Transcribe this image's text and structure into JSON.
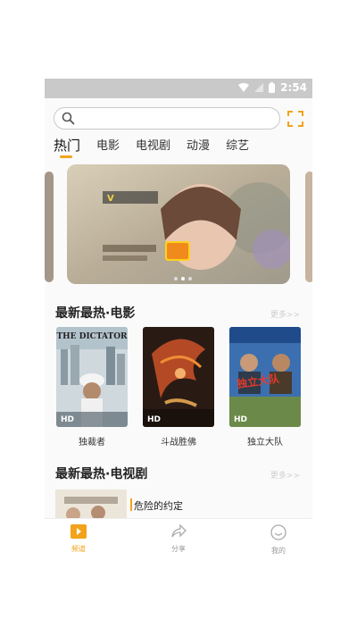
{
  "status_bar": {
    "time": "2:54",
    "icons": [
      "wifi-icon",
      "signal-icon",
      "battery-icon"
    ]
  },
  "search": {
    "placeholder": "",
    "icon": "search-icon"
  },
  "scan": {
    "icon": "scan-icon"
  },
  "tabs": [
    {
      "label": "热门",
      "active": true
    },
    {
      "label": "电影",
      "active": false
    },
    {
      "label": "电视剧",
      "active": false
    },
    {
      "label": "动漫",
      "active": false
    },
    {
      "label": "综艺",
      "active": false
    }
  ],
  "carousel": {
    "slide_count": 3,
    "active_index": 1
  },
  "movie_section": {
    "title": "最新最热·电影",
    "more": "更多>>",
    "items": [
      {
        "title": "独裁者",
        "badge": "HD",
        "poster_text": "THE DICTATOR"
      },
      {
        "title": "斗战胜佛",
        "badge": "HD",
        "poster_text": ""
      },
      {
        "title": "独立大队",
        "badge": "HD",
        "poster_text": "独立大队"
      }
    ]
  },
  "tv_section": {
    "title": "最新最热·电视剧",
    "more": "更多>>",
    "items": [
      {
        "title": "危险的约定"
      }
    ]
  },
  "bottom_nav": [
    {
      "label": "频道",
      "icon": "play-icon",
      "active": true
    },
    {
      "label": "分享",
      "icon": "share-icon",
      "active": false
    },
    {
      "label": "我的",
      "icon": "profile-icon",
      "active": false
    }
  ],
  "colors": {
    "accent": "#f2a31b",
    "statusbar": "#c9c9c9",
    "background": "#fafafa"
  }
}
